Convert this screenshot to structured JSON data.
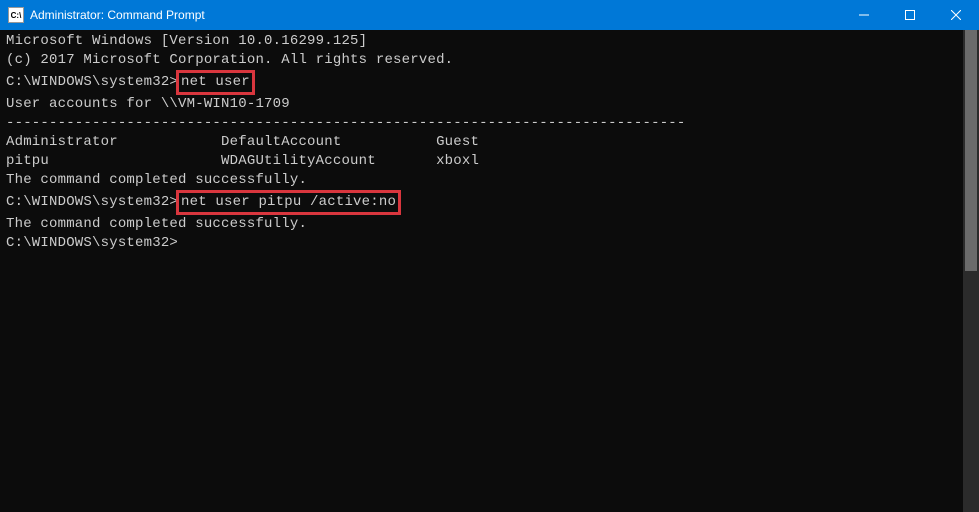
{
  "titlebar": {
    "icon_label": "C:\\",
    "title": "Administrator: Command Prompt"
  },
  "terminal": {
    "header_line1": "Microsoft Windows [Version 10.0.16299.125]",
    "header_line2": "(c) 2017 Microsoft Corporation. All rights reserved.",
    "blank": "",
    "prompt1_path": "C:\\WINDOWS\\system32>",
    "cmd1": "net user",
    "accounts_for": "User accounts for \\\\VM-WIN10-1709",
    "divider": "-------------------------------------------------------------------------------",
    "row1": "Administrator            DefaultAccount           Guest",
    "row2": "pitpu                    WDAGUtilityAccount       xboxl",
    "completed1": "The command completed successfully.",
    "prompt2_path": "C:\\WINDOWS\\system32>",
    "cmd2": "net user pitpu /active:no",
    "completed2": "The command completed successfully.",
    "prompt3": "C:\\WINDOWS\\system32>"
  },
  "highlights": {
    "cmd1_box": true,
    "cmd2_box": true
  }
}
